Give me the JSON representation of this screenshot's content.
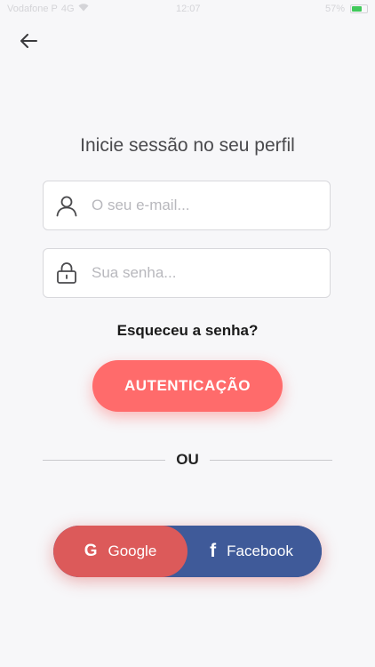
{
  "status_bar": {
    "carrier": "Vodafone P",
    "network": "4G",
    "time": "12:07",
    "battery_percent": "57%",
    "battery_color": "#41c95b"
  },
  "header": {
    "back_icon": "arrow-left-icon"
  },
  "login": {
    "title": "Inicie sessão no seu perfil",
    "email_placeholder": "O seu e-mail...",
    "password_placeholder": "Sua senha...",
    "forgot_label": "Esqueceu a senha?",
    "auth_label": "AUTENTICAÇÃO",
    "or_label": "OU"
  },
  "social": {
    "google_label": "Google",
    "facebook_label": "Facebook",
    "google_color": "#dc5a5a",
    "facebook_color": "#3f5a99"
  },
  "theme": {
    "accent": "#ff6b6b",
    "background": "#f7f7f9"
  }
}
